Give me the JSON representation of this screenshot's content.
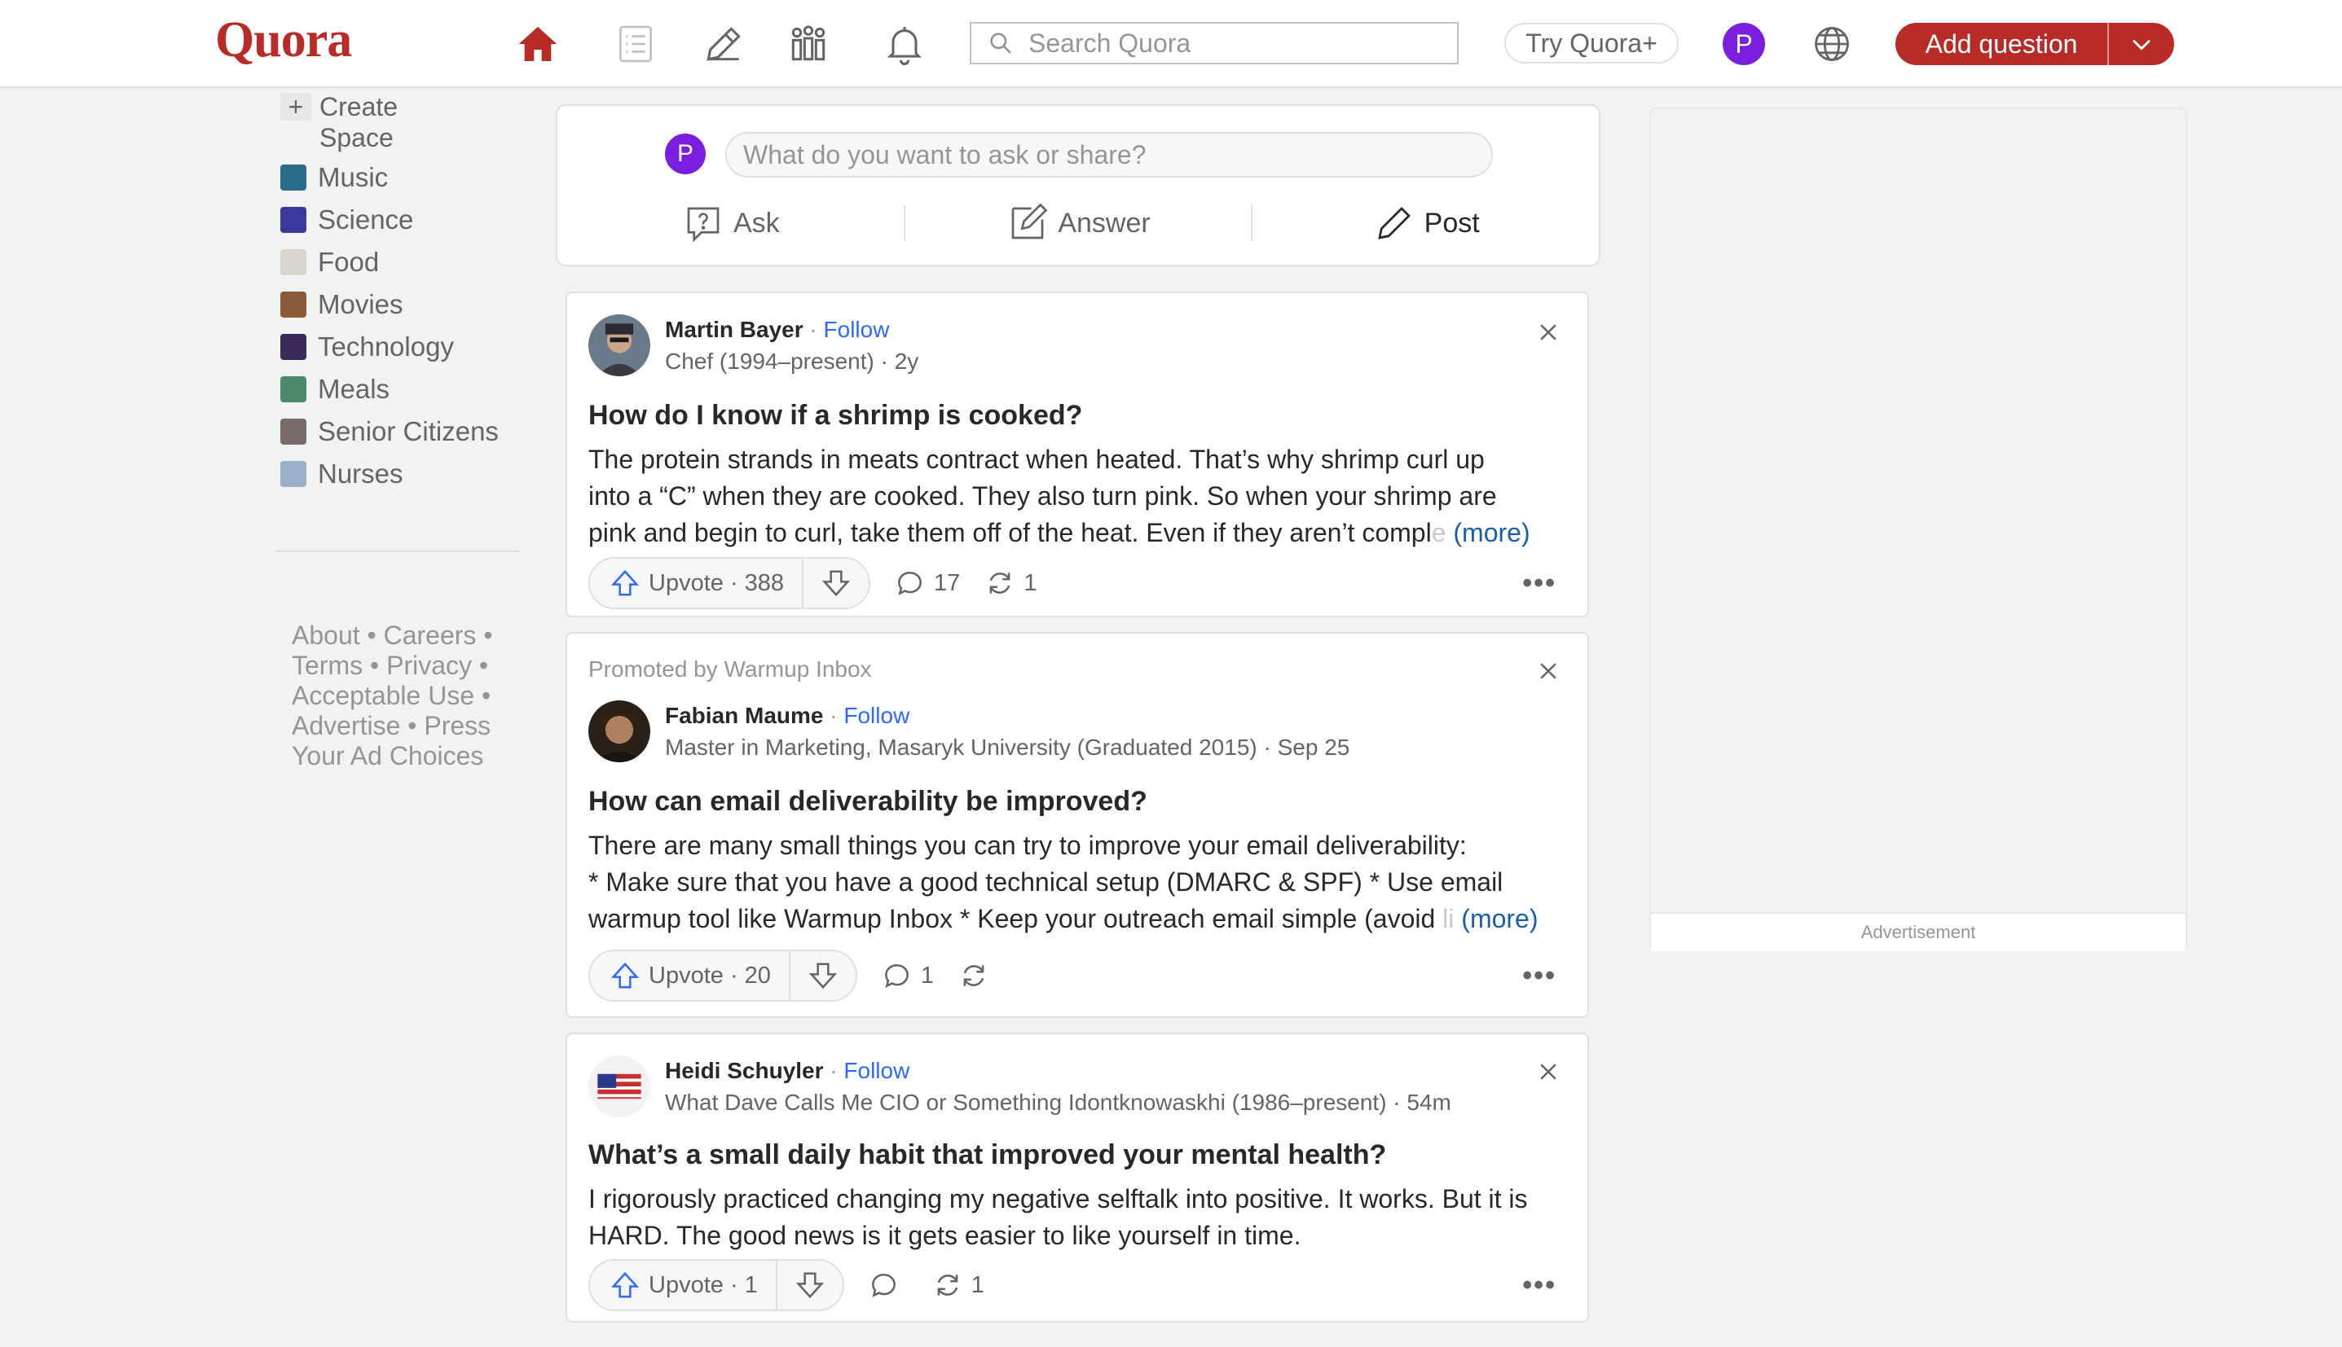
{
  "header": {
    "logo": "Quora",
    "nav_icons": [
      "home-icon",
      "following-icon",
      "answer-icon",
      "spaces-icon",
      "notifications-icon"
    ],
    "search": {
      "placeholder": "Search Quora",
      "value": ""
    },
    "try_plus": "Try Quora+",
    "avatar_initial": "P",
    "add_question": "Add question",
    "accent_color": "#b92b27",
    "avatar_color": "#7c1ee0"
  },
  "sidebar": {
    "create_space_line1": "Create",
    "create_space_line2": "Space",
    "spaces": [
      {
        "label": "Music",
        "color": "#2a6b8a"
      },
      {
        "label": "Science",
        "color": "#3b3a9c"
      },
      {
        "label": "Food",
        "color": "#d9d4cc"
      },
      {
        "label": "Movies",
        "color": "#8a5a3a"
      },
      {
        "label": "Technology",
        "color": "#3a2a5a"
      },
      {
        "label": "Meals",
        "color": "#4a8a6a"
      },
      {
        "label": "Senior Citizens",
        "color": "#7a6a6a"
      },
      {
        "label": "Nurses",
        "color": "#9ab0c8"
      }
    ],
    "footer": {
      "line1": "About • Careers •",
      "line2": "Terms • Privacy •",
      "line3": "Acceptable Use •",
      "line4": "Advertise • Press",
      "line5": "Your Ad Choices"
    }
  },
  "composer": {
    "avatar_initial": "P",
    "placeholder": "What do you want to ask or share?",
    "ask": "Ask",
    "answer": "Answer",
    "post": "Post"
  },
  "feed": [
    {
      "author": "Martin Bayer",
      "separator": "·",
      "follow": "Follow",
      "credential": "Chef (1994–present) · 2y",
      "question": "How do I know if a shrimp is cooked?",
      "line1": "The protein strands in meats contract when heated. That’s why shrimp curl up",
      "line2": "into a “C” when they are cooked. They also turn pink. So when your shrimp are",
      "line3": "pink and begin to curl, take them off of the heat. Even if they aren’t compl",
      "line3_fade": "e",
      "more": "(more)",
      "upvote": "Upvote · 388",
      "comments": "17",
      "shares": "1"
    },
    {
      "promoted": "Promoted by Warmup Inbox",
      "author": "Fabian Maume",
      "separator": "·",
      "follow": "Follow",
      "credential": "Master in Marketing, Masaryk University (Graduated 2015) · Sep 25",
      "question": "How can email deliverability be improved?",
      "line1": "There are many small things you can try to improve your email deliverability:",
      "line2": "* Make sure that you have a good technical setup (DMARC & SPF) * Use email",
      "line3": "warmup tool like Warmup Inbox * Keep your outreach email simple (avoid",
      "line3_fade": " li",
      "more": "(more)",
      "upvote": "Upvote · 20",
      "comments": "1",
      "shares": ""
    },
    {
      "author": "Heidi Schuyler",
      "separator": "·",
      "follow": "Follow",
      "credential": "What Dave Calls Me CIO or Something Idontknowaskhi (1986–present) · 54m",
      "question": "What’s a small daily habit that improved your mental health?",
      "line1": "I rigorously practiced changing my negative selftalk into positive. It works. But it is",
      "line2": "HARD. The good news is it gets easier to like yourself in time.",
      "upvote": "Upvote · 1",
      "comments": "",
      "shares": "1"
    }
  ],
  "ad": {
    "label": "Advertisement"
  }
}
